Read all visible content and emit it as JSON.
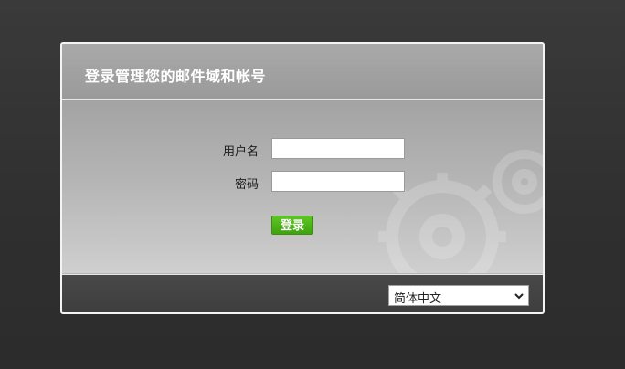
{
  "header": {
    "title": "登录管理您的邮件域和帐号"
  },
  "form": {
    "username_label": "用户名",
    "username_value": "",
    "password_label": "密码",
    "password_value": "",
    "login_label": "登录"
  },
  "footer": {
    "language_selected": "简体中文"
  },
  "colors": {
    "login_button": "#4cb51a",
    "page_background": "#333333"
  },
  "icons": {
    "select_arrow": "chevron-down-icon",
    "decor": "gears-icon"
  }
}
